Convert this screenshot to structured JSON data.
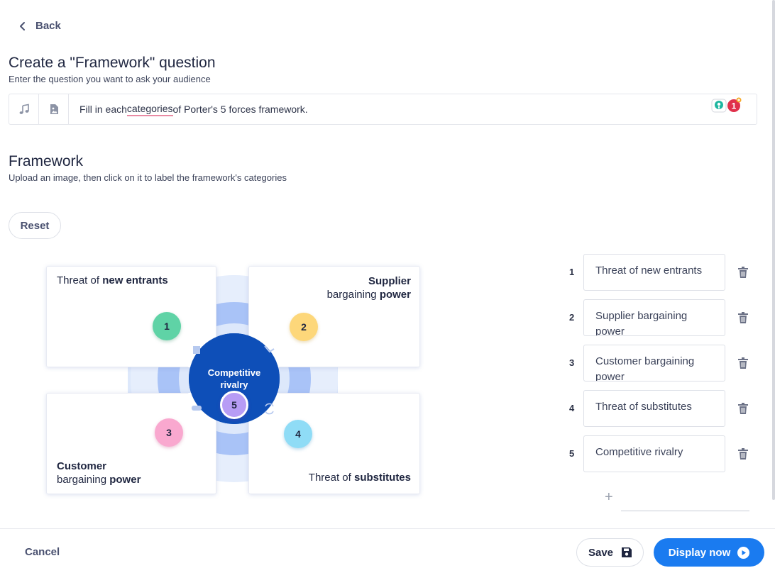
{
  "nav": {
    "back_label": "Back"
  },
  "question": {
    "title": "Create a \"Framework\" question",
    "subtitle": "Enter the question you want to ask your audience",
    "text_before": "Fill in each ",
    "text_misspelled": "categories",
    "text_after": " of Porter's 5 forces framework.",
    "icons": [
      "music-note-icon",
      "image-icon"
    ],
    "extension_badge_count": "1"
  },
  "framework": {
    "title": "Framework",
    "subtitle": "Upload an image, then click on it to label the framework's categories",
    "reset_label": "Reset",
    "image": {
      "card1": {
        "pre": "Threat of ",
        "bold": "new entrants"
      },
      "card2": {
        "bold": "Supplier",
        "line2_pre": "bargaining ",
        "line2_bold": "power"
      },
      "card3": {
        "bold": "Customer",
        "line2_pre": "bargaining ",
        "line2_bold": "power"
      },
      "card4": {
        "pre": "Threat of ",
        "bold": "substitutes"
      },
      "center_line1": "Competitive",
      "center_line2": "rivalry",
      "markers": [
        "1",
        "2",
        "3",
        "4",
        "5"
      ]
    },
    "categories": [
      {
        "number": "1",
        "label": "Threat of new entrants"
      },
      {
        "number": "2",
        "label": "Supplier bargaining power"
      },
      {
        "number": "3",
        "label": "Customer bargaining power"
      },
      {
        "number": "4",
        "label": "Threat of substitutes"
      },
      {
        "number": "5",
        "label": "Competitive rivalry"
      }
    ],
    "add_symbol": "+"
  },
  "footer": {
    "cancel_label": "Cancel",
    "save_label": "Save",
    "display_label": "Display now"
  },
  "colors": {
    "primary": "#1a7bf0",
    "badge1": "#5fd3a6",
    "badge2": "#fdd77a",
    "badge3": "#f9a8cf",
    "badge4": "#8fdcf6",
    "badge5": "#b79cf5",
    "center": "#0e4fb8"
  }
}
